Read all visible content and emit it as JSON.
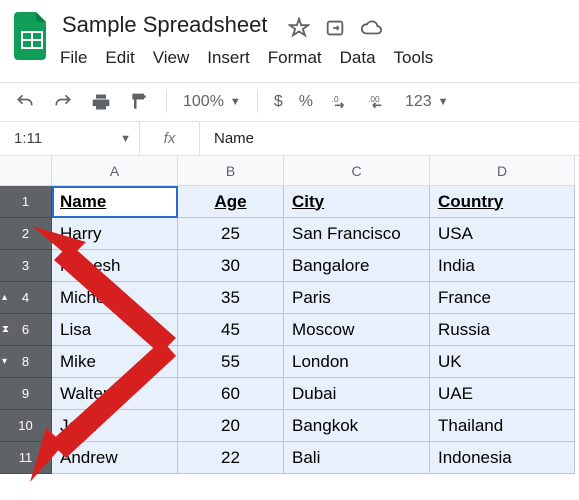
{
  "document": {
    "title": "Sample Spreadsheet"
  },
  "menus": [
    "File",
    "Edit",
    "View",
    "Insert",
    "Format",
    "Data",
    "Tools"
  ],
  "toolbar": {
    "zoom": "100%",
    "currency": "$",
    "percent": "%",
    "numfmt": "123"
  },
  "formula_bar": {
    "name_box": "1:11",
    "fx": "fx",
    "value": "Name"
  },
  "grid": {
    "columns": [
      "A",
      "B",
      "C",
      "D"
    ],
    "rows": [
      {
        "num": "1",
        "mark": "",
        "cells": [
          "Name",
          "Age",
          "City",
          "Country"
        ]
      },
      {
        "num": "2",
        "mark": "",
        "cells": [
          "Harry",
          "25",
          "San Francisco",
          "USA"
        ]
      },
      {
        "num": "3",
        "mark": "",
        "cells": [
          "Mahesh",
          "30",
          "Bangalore",
          "India"
        ]
      },
      {
        "num": "4",
        "mark": "▴",
        "cells": [
          "Michelle",
          "35",
          "Paris",
          "France"
        ]
      },
      {
        "num": "6",
        "mark": "⧗",
        "cells": [
          "Lisa",
          "45",
          "Moscow",
          "Russia"
        ]
      },
      {
        "num": "8",
        "mark": "▾",
        "cells": [
          "Mike",
          "55",
          "London",
          "UK"
        ]
      },
      {
        "num": "9",
        "mark": "",
        "cells": [
          "Walter",
          "60",
          "Dubai",
          "UAE"
        ]
      },
      {
        "num": "10",
        "mark": "",
        "cells": [
          "John",
          "20",
          "Bangkok",
          "Thailand"
        ]
      },
      {
        "num": "11",
        "mark": "",
        "cells": [
          "Andrew",
          "22",
          "Bali",
          "Indonesia"
        ]
      }
    ]
  }
}
